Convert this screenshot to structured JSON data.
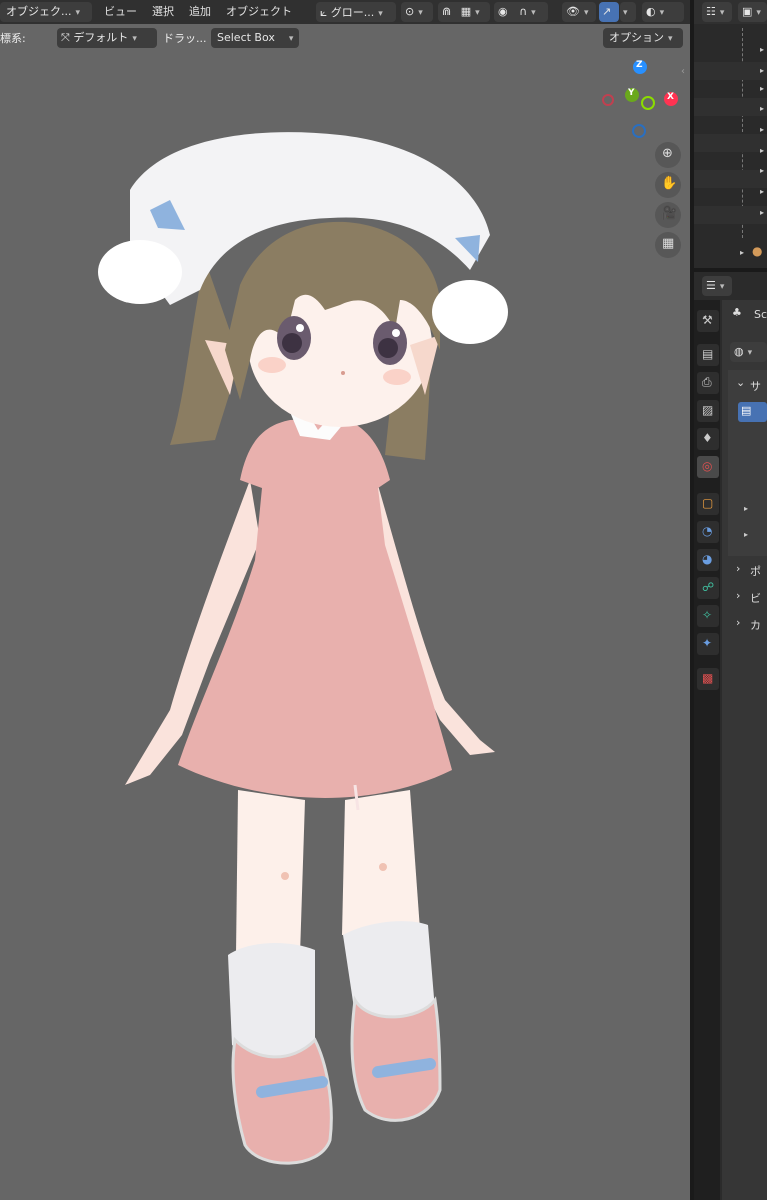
{
  "header": {
    "mode_label": "オブジェク...",
    "menu": [
      "ビュー",
      "選択",
      "追加",
      "オブジェクト"
    ],
    "orientation_label": "グロー...",
    "snap_icon": "magnet-icon",
    "overlay_icon": "overlay-icon"
  },
  "toolbar2": {
    "coord_label": "標系:",
    "pivot_label": "デフォルト",
    "drag_label": "ドラッ...",
    "select_label": "Select Box",
    "options_label": "オプション"
  },
  "gizmo": {
    "z": "Z",
    "y": "Y",
    "x": "X"
  },
  "properties": {
    "scene_label": "Sc",
    "section_labels": [
      "サ",
      "ポ",
      "ビ",
      "カ"
    ]
  },
  "colors": {
    "header_bg": "#303030",
    "viewport_bg": "#666666",
    "accent_blue": "#4772b3",
    "axis_x": "#ff3352",
    "axis_y": "#8bdc00",
    "axis_z": "#2890ff"
  }
}
